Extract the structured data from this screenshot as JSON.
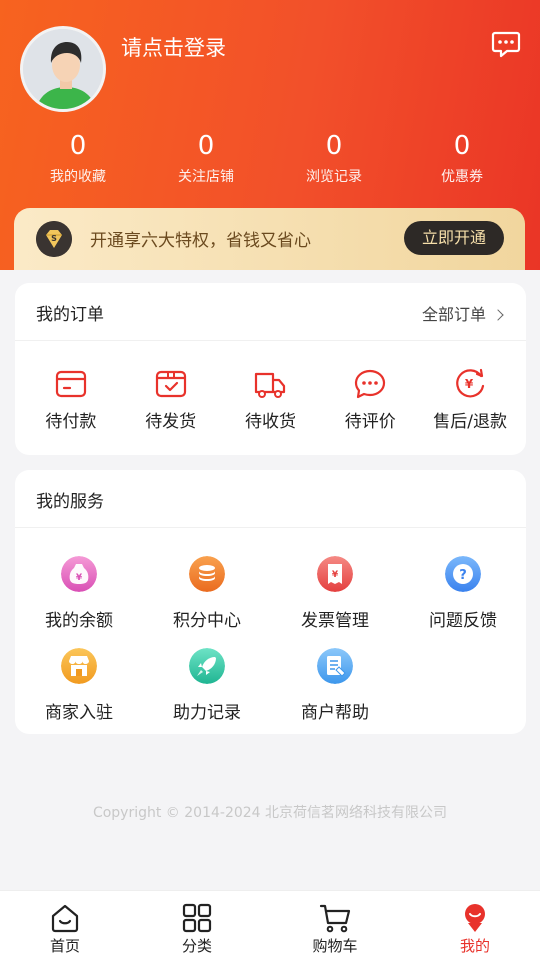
{
  "profile": {
    "login_text": "请点击登录"
  },
  "stats": [
    {
      "value": "0",
      "label": "我的收藏"
    },
    {
      "value": "0",
      "label": "关注店铺"
    },
    {
      "value": "0",
      "label": "浏览记录"
    },
    {
      "value": "0",
      "label": "优惠券"
    }
  ],
  "vip": {
    "text": "开通享六大特权，省钱又省心",
    "button": "立即开通"
  },
  "orders": {
    "title": "我的订单",
    "all_label": "全部订单",
    "items": [
      {
        "label": "待付款",
        "icon": "wallet-icon"
      },
      {
        "label": "待发货",
        "icon": "box-check-icon"
      },
      {
        "label": "待收货",
        "icon": "truck-icon"
      },
      {
        "label": "待评价",
        "icon": "comment-icon"
      },
      {
        "label": "售后/退款",
        "icon": "refund-icon"
      }
    ]
  },
  "services": {
    "title": "我的服务",
    "items": [
      {
        "label": "我的余额",
        "icon": "money-bag-icon",
        "color": "#e84fc0"
      },
      {
        "label": "积分中心",
        "icon": "coins-icon",
        "color": "#f07a2a"
      },
      {
        "label": "发票管理",
        "icon": "invoice-icon",
        "color": "#ec4c4c"
      },
      {
        "label": "问题反馈",
        "icon": "question-icon",
        "color": "#3f8ff2"
      },
      {
        "label": "商家入驻",
        "icon": "store-icon",
        "color": "#f5a623"
      },
      {
        "label": "助力记录",
        "icon": "rocket-icon",
        "color": "#2fc4a2"
      },
      {
        "label": "商户帮助",
        "icon": "document-icon",
        "color": "#4fa7f0"
      }
    ]
  },
  "copyright": "Copyright © 2014-2024 北京荷信茗网络科技有限公司",
  "tabbar": [
    {
      "label": "首页",
      "icon": "home-icon"
    },
    {
      "label": "分类",
      "icon": "grid-icon"
    },
    {
      "label": "购物车",
      "icon": "cart-icon"
    },
    {
      "label": "我的",
      "icon": "profile-icon",
      "active": true
    }
  ],
  "colors": {
    "accent": "#e8322b",
    "header_start": "#f7631f",
    "header_end": "#ea3526",
    "vip_gold": "#f1d69e"
  }
}
